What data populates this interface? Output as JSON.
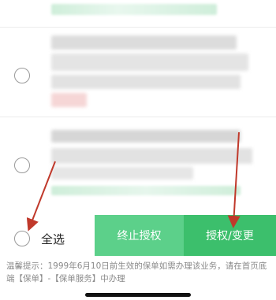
{
  "footer": {
    "select_all_label": "全选",
    "terminate_button": "终止授权",
    "authorize_button": "授权/变更"
  },
  "tip": {
    "text": "温馨提示：1999年6月10日前生效的保单如需办理该业务，请在首页底端【保单】-【保单服务】中办理"
  },
  "colors": {
    "accent_green": "#3cbf6c",
    "accent_green_light": "#5cd08a",
    "annotation_red": "#c0392b"
  }
}
